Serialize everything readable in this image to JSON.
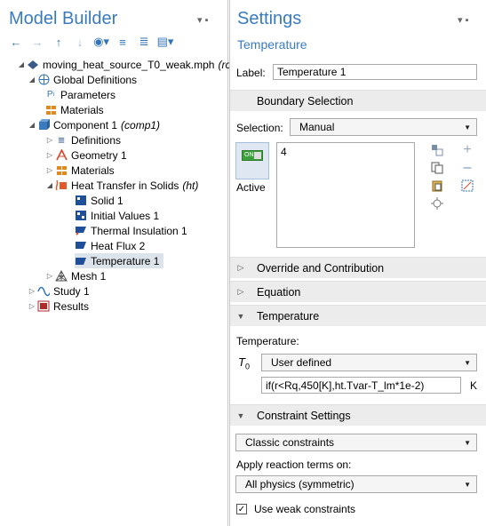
{
  "model_builder": {
    "title": "Model Builder",
    "pin": "▾ ▪",
    "tree": [
      {
        "label": "moving_heat_source_T0_weak.mph",
        "suffix": "(ro",
        "expander": "◢",
        "icon": "model-icon",
        "icon_color": "#3a5a8a"
      },
      {
        "label": "Global Definitions",
        "suffix": "",
        "expander": "◢",
        "icon": "globe-icon",
        "icon_color": "#3273b9"
      },
      {
        "label": "Parameters",
        "suffix": "",
        "expander": "",
        "icon": "parameters-icon",
        "icon_color": "#3273b9"
      },
      {
        "label": "Materials",
        "suffix": "",
        "expander": "",
        "icon": "materials-icon",
        "icon_color": "#e08a1e"
      },
      {
        "label": "Component 1",
        "suffix": "(comp1)",
        "expander": "◢",
        "icon": "component-icon",
        "icon_color": "#3a7bbf"
      },
      {
        "label": "Definitions",
        "suffix": "",
        "expander": "▷",
        "icon": "definitions-icon",
        "icon_color": "#2b4f8a"
      },
      {
        "label": "Geometry 1",
        "suffix": "",
        "expander": "▷",
        "icon": "geometry-icon",
        "icon_color": "#d9442b"
      },
      {
        "label": "Materials",
        "suffix": "",
        "expander": "▷",
        "icon": "materials-icon",
        "icon_color": "#e08a1e"
      },
      {
        "label": "Heat Transfer in Solids",
        "suffix": "(ht)",
        "expander": "◢",
        "icon": "heat-transfer-icon",
        "icon_color": "#e05a2b"
      },
      {
        "label": "Solid 1",
        "suffix": "",
        "expander": "",
        "icon": "solid-icon",
        "icon_color": "#1f4f99"
      },
      {
        "label": "Initial Values 1",
        "suffix": "",
        "expander": "",
        "icon": "initial-values-icon",
        "icon_color": "#1f4f99"
      },
      {
        "label": "Thermal Insulation 1",
        "suffix": "",
        "expander": "",
        "icon": "thermal-insulation-icon",
        "icon_color": "#1f4f99"
      },
      {
        "label": "Heat Flux 2",
        "suffix": "",
        "expander": "",
        "icon": "heat-flux-icon",
        "icon_color": "#1f4f99"
      },
      {
        "label": "Temperature 1",
        "suffix": "",
        "expander": "",
        "icon": "temperature-icon",
        "icon_color": "#1f4f99",
        "selected": true
      },
      {
        "label": "Mesh 1",
        "suffix": "",
        "expander": "▷",
        "icon": "mesh-icon",
        "icon_color": "#555555"
      },
      {
        "label": "Study 1",
        "suffix": "",
        "expander": "▷",
        "icon": "study-icon",
        "icon_color": "#3273b9"
      },
      {
        "label": "Results",
        "suffix": "",
        "expander": "▷",
        "icon": "results-icon",
        "icon_color": "#b02a2a"
      }
    ]
  },
  "settings": {
    "title": "Settings",
    "pin": "▾ ▪",
    "subtitle": "Temperature",
    "label_caption": "Label:",
    "label_value": "Temperature 1",
    "boundary_selection": {
      "section": "Boundary Selection",
      "selection_caption": "Selection:",
      "selection_value": "Manual",
      "list_value": "4",
      "toggle_text": "ON",
      "active_label": "Active"
    },
    "collapsed_sections": [
      "Override and Contribution",
      "Equation"
    ],
    "temperature_section": {
      "section": "Temperature",
      "caption": "Temperature:",
      "symbol": "T",
      "symbol_sub": "0",
      "mode": "User defined",
      "expression": "if(r<Rq,450[K],ht.Tvar-T_lm*1e-2)",
      "unit": "K"
    },
    "constraint_section": {
      "section": "Constraint Settings",
      "constraint_type": "Classic constraints",
      "reaction_caption": "Apply reaction terms on:",
      "reaction_value": "All physics (symmetric)",
      "weak_checkbox_label": "Use weak constraints",
      "weak_checked": true
    }
  }
}
